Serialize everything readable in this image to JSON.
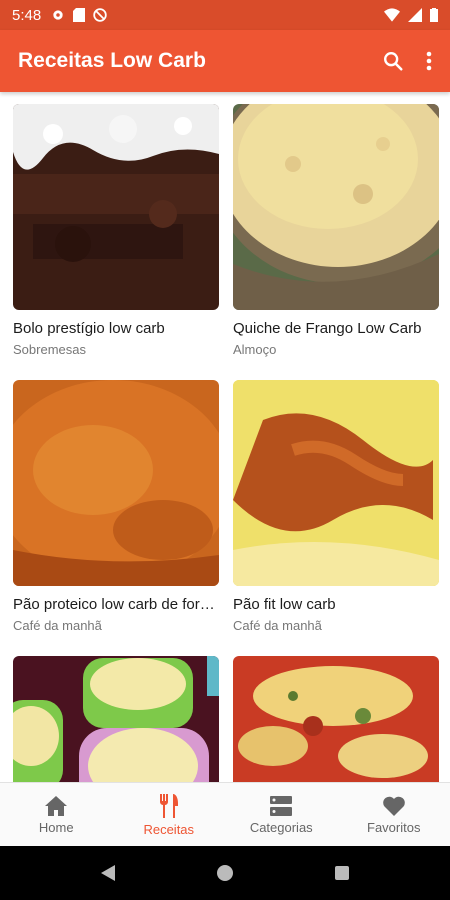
{
  "status_bar": {
    "time": "5:48"
  },
  "app_bar": {
    "title": "Receitas Low Carb"
  },
  "recipes": [
    {
      "name": "Bolo prestígio low carb",
      "category": "Sobremesas"
    },
    {
      "name": "Quiche de Frango Low Carb",
      "category": "Almoço"
    },
    {
      "name": "Pão proteico low carb de forma",
      "category": "Café da manhã"
    },
    {
      "name": "Pão fit low carb",
      "category": "Café da manhã"
    },
    {
      "name": "",
      "category": ""
    },
    {
      "name": "",
      "category": ""
    }
  ],
  "bottom_nav": {
    "items": [
      {
        "label": "Home",
        "icon": "home-icon"
      },
      {
        "label": "Receitas",
        "icon": "fork-knife-icon",
        "active": true
      },
      {
        "label": "Categorias",
        "icon": "categories-icon"
      },
      {
        "label": "Favoritos",
        "icon": "heart-icon"
      }
    ]
  },
  "colors": {
    "primary": "#ee5533",
    "status_bar": "#d94c2a",
    "active_tab": "#ee5533"
  }
}
